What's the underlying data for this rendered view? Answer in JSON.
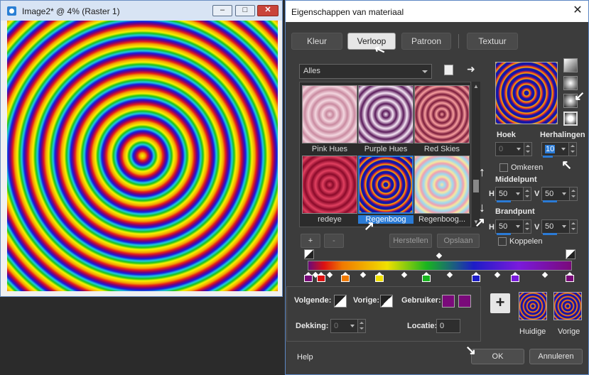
{
  "image_window": {
    "title": "Image2* @   4% (Raster 1)",
    "min_label": "–",
    "max_label": "□",
    "close_label": "✕"
  },
  "dialog": {
    "title": "Eigenschappen van materiaal",
    "close_label": "✕",
    "tabs": [
      "Kleur",
      "Verloop",
      "Patroon",
      "Textuur"
    ],
    "active_tab": "Verloop",
    "category_select": "Alles",
    "gradients": [
      {
        "name": "Pink Hues"
      },
      {
        "name": "Purple Hues"
      },
      {
        "name": "Red Skies"
      },
      {
        "name": "redeye"
      },
      {
        "name": "Regenboog"
      },
      {
        "name": "Regenboog..."
      }
    ],
    "selected_gradient": "Regenboog",
    "add_label": "+",
    "remove_label": "-",
    "reset_label": "Herstellen",
    "save_label": "Opslaan",
    "angle_label": "Hoek",
    "angle_value": "0",
    "repeats_label": "Herhalingen",
    "repeats_value": "10",
    "invert_label": "Omkeren",
    "center_label": "Middelpunt",
    "center_h_label": "H",
    "center_h_value": "50",
    "center_v_label": "V",
    "center_v_value": "50",
    "focal_label": "Brandpunt",
    "focal_h_label": "H",
    "focal_h_value": "50",
    "focal_v_label": "V",
    "focal_v_value": "50",
    "link_label": "Koppelen",
    "next_label": "Volgende:",
    "prev_label": "Vorige:",
    "user_label": "Gebruiker:",
    "user_color": "#7a0a7a",
    "opacity_label": "Dekking:",
    "opacity_value": "0",
    "location_label": "Locatie:",
    "location_value": "0",
    "current_label": "Huidige",
    "previous_label": "Vorige",
    "help_label": "Help",
    "ok_label": "OK",
    "cancel_label": "Annuleren",
    "color_stops": [
      "#7a0a7a",
      "#dd1111",
      "#f07a00",
      "#f0e000",
      "#19b51f",
      "#1d1dc8",
      "#7a1adc",
      "#7a0a7a"
    ]
  }
}
